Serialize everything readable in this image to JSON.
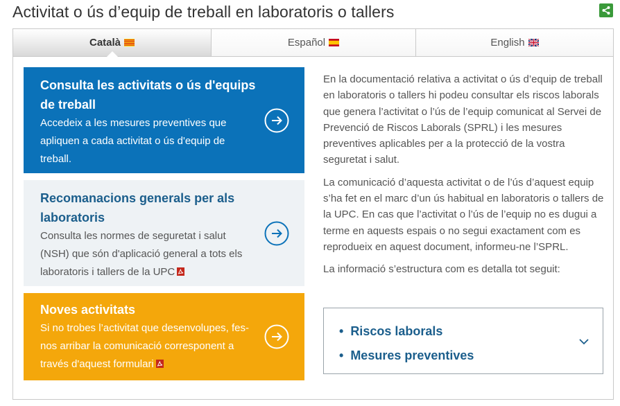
{
  "header": {
    "title": "Activitat o ús d’equip de treball en laboratoris o tallers",
    "share_icon": "share-icon"
  },
  "tabs": [
    {
      "label": "Català",
      "flag_icon": "catalan-flag-icon",
      "active": true
    },
    {
      "label": "Español",
      "flag_icon": "spanish-flag-icon",
      "active": false
    },
    {
      "label": "English",
      "flag_icon": "uk-flag-icon",
      "active": false
    }
  ],
  "cards": [
    {
      "title": "Consulta les activitats o ús d'equips de treball",
      "description": "Accedeix a les mesures preventives que apliquen a cada activitat o ús d'equip de treball.",
      "icon": "arrow-right-circle-icon",
      "color": "#0b72b9"
    },
    {
      "title": "Recomanacions generals per als laboratoris",
      "description": "Consulta les normes de seguretat i salut (NSH) que són d'aplicació general a tots els laboratoris i tallers de la UPC",
      "icon": "arrow-right-circle-icon",
      "pdf_icon": "pdf-icon",
      "color": "#eef2f5"
    },
    {
      "title": "Noves activitats",
      "description": "Si no trobes l’activitat que desenvolupes, fes-nos arribar la comunicació corresponent a través d'aquest formulari",
      "icon": "arrow-right-circle-icon",
      "pdf_icon": "pdf-icon",
      "color": "#f4a70b"
    }
  ],
  "intro": {
    "paragraphs": [
      "En la documentació relativa a activitat o ús d’equip de treball en laboratoris o tallers hi podeu consultar els riscos laborals que genera l’activitat o l’ús de l’equip comunicat al Servei de Prevenció de Riscos Laborals (SPRL) i les mesures preventives aplicables per a la protecció de la vostra seguretat i salut.",
      "La comunicació d’aquesta activitat o de l’ús d’aquest equip s’ha fet en el marc d’un ús habitual en laboratoris o tallers de la UPC. En cas que l’activitat o l’ús de l’equip no es dugui a terme en aquests espais o no segui exactament com es reprodueix en aquest document, informeu-ne l’SPRL.",
      "La informació s’estructura com es detalla tot seguit:"
    ]
  },
  "structure": {
    "items": [
      "Riscos laborals",
      "Mesures preventives"
    ],
    "toggle_icon": "chevron-down-icon"
  }
}
